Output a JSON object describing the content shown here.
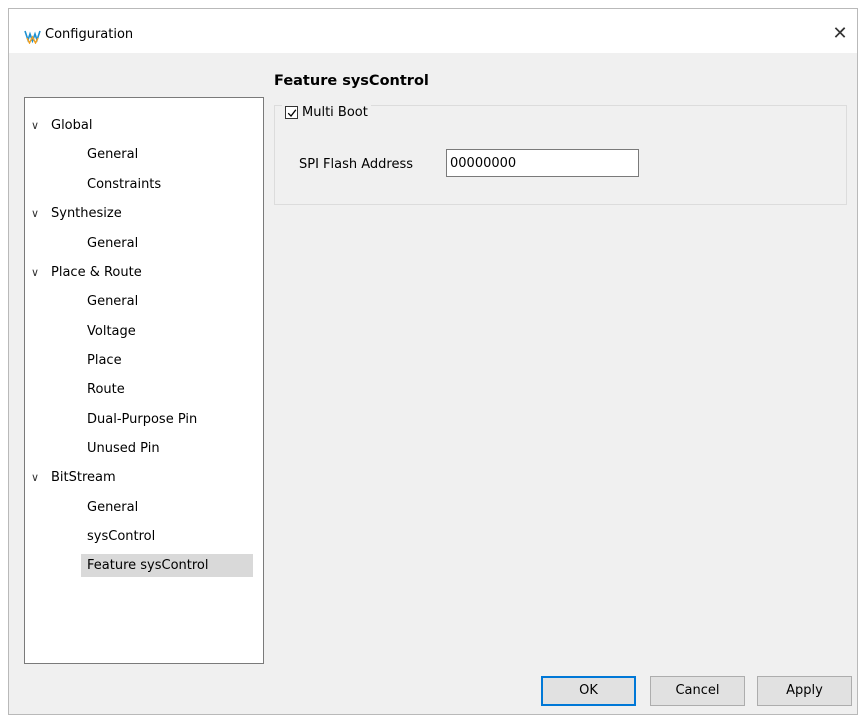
{
  "window": {
    "title": "Configuration",
    "close_glyph": "✕"
  },
  "tree": {
    "groups": [
      {
        "label": "Global",
        "expanded": true,
        "children": [
          "General",
          "Constraints"
        ]
      },
      {
        "label": "Synthesize",
        "expanded": true,
        "children": [
          "General"
        ]
      },
      {
        "label": "Place & Route",
        "expanded": true,
        "children": [
          "General",
          "Voltage",
          "Place",
          "Route",
          "Dual-Purpose Pin",
          "Unused Pin"
        ]
      },
      {
        "label": "BitStream",
        "expanded": true,
        "children": [
          "General",
          "sysControl",
          "Feature sysControl"
        ]
      }
    ],
    "selected": "Feature sysControl"
  },
  "panel": {
    "heading": "Feature sysControl",
    "multi_boot": {
      "label": "Multi Boot",
      "checked": true
    },
    "spi_flash": {
      "label": "SPI Flash Address",
      "value": "00000000"
    }
  },
  "buttons": {
    "ok": "OK",
    "cancel": "Cancel",
    "apply": "Apply"
  },
  "colors": {
    "accent": "#0078d7",
    "selection": "#d9d9d9",
    "dialog_bg": "#f0f0f0"
  }
}
